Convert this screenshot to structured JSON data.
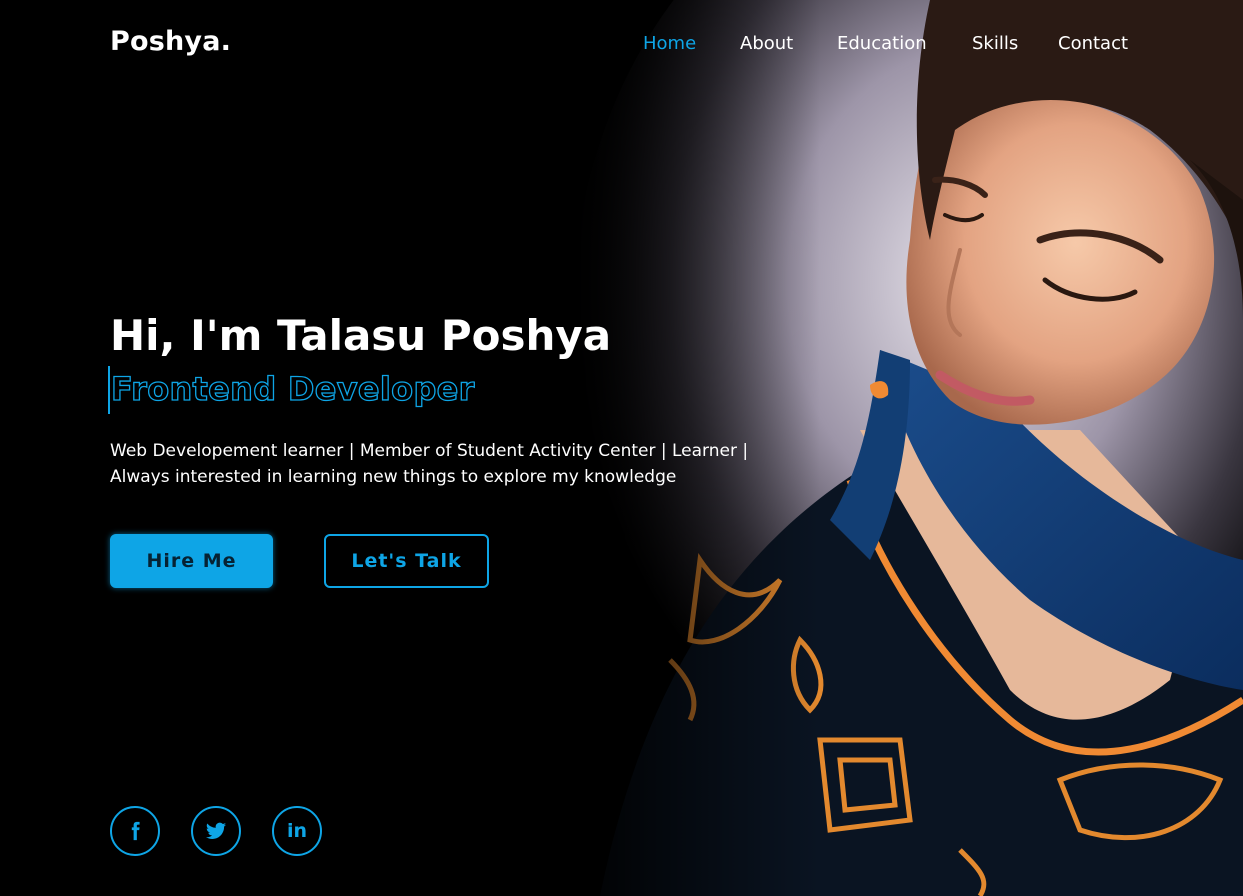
{
  "brand": {
    "logo": "Poshya."
  },
  "nav": {
    "items": [
      {
        "label": "Home",
        "active": true
      },
      {
        "label": "About",
        "active": false
      },
      {
        "label": "Education",
        "active": false
      },
      {
        "label": "Skills",
        "active": false
      },
      {
        "label": "Contact",
        "active": false
      }
    ]
  },
  "hero": {
    "greeting": "Hi, I'm Talasu Poshya",
    "role": "Frontend Developer",
    "bio": "Web Developement learner | Member of Student Activity Center | Learner | Always interested in learning new things to explore my knowledge",
    "buttons": {
      "hire": "Hire Me",
      "talk": "Let's Talk"
    }
  },
  "social": {
    "icons": [
      "facebook-icon",
      "twitter-icon",
      "linkedin-icon"
    ],
    "linkedin_glyph": "in"
  },
  "colors": {
    "accent": "#0ea5e6",
    "background": "#000000",
    "text": "#ffffff"
  }
}
